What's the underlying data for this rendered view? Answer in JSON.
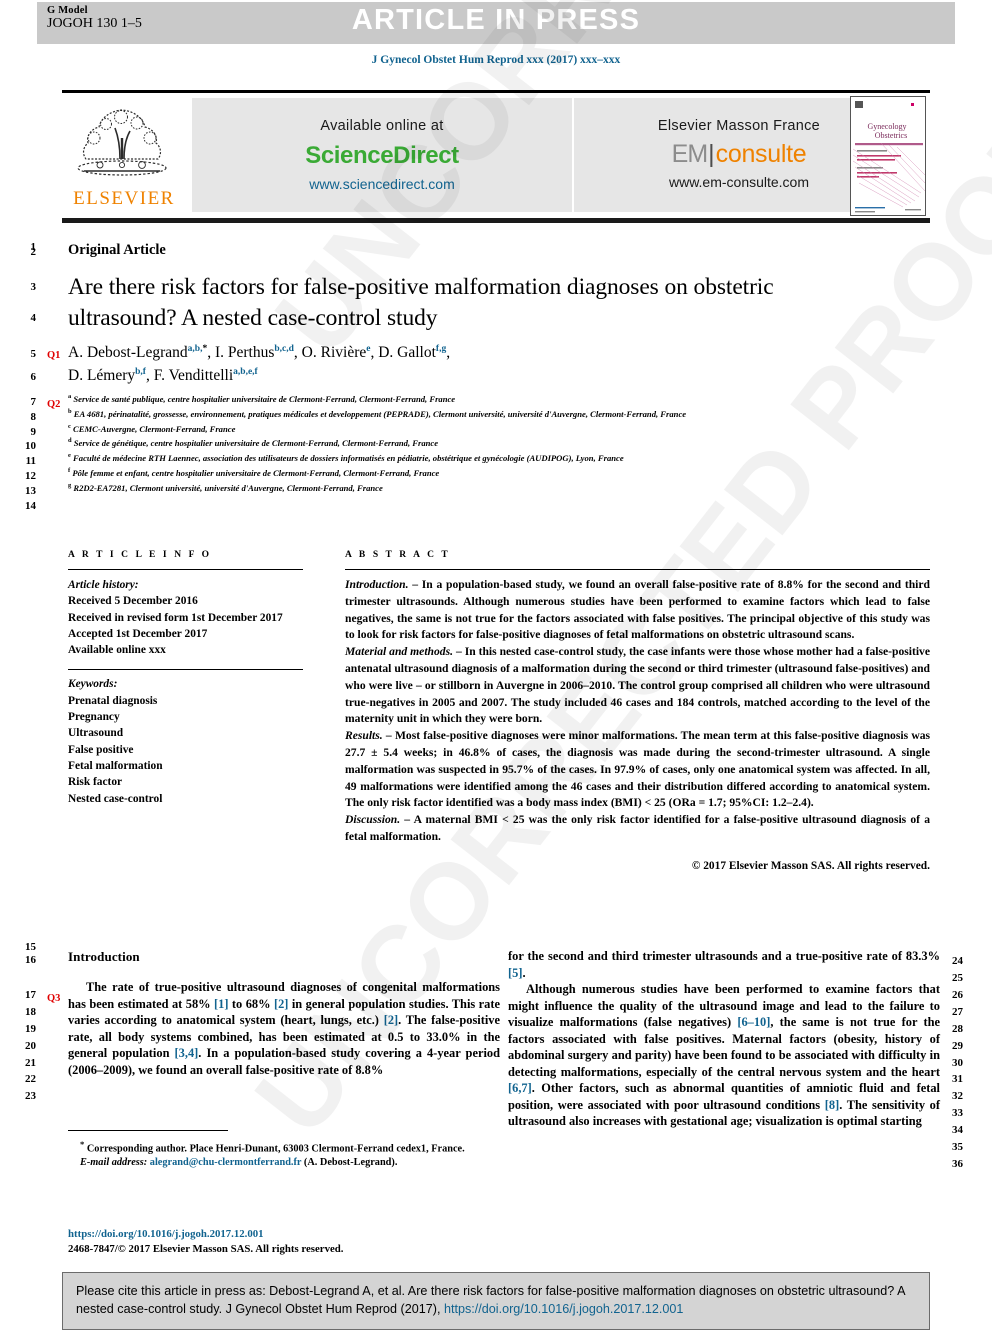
{
  "header": {
    "g_model_label": "G Model",
    "journal_code": "JOGOH 130 1–5",
    "status_banner": "ARTICLE IN PRESS",
    "journal_line": "J Gynecol Obstet Hum Reprod xxx (2017) xxx–xxx"
  },
  "masthead": {
    "elsevier_wordmark": "ELSEVIER",
    "sciencedirect": {
      "available_label": "Available online at",
      "brand": "ScienceDirect",
      "url": "www.sciencedirect.com"
    },
    "emconsulte": {
      "publisher": "Elsevier Masson France",
      "brand_first": "EM",
      "brand_divider": "|",
      "brand_second": "consulte",
      "url": "www.em-consulte.com"
    },
    "cover_title_line1": "Gynecology",
    "cover_title_line2": "Obstetrics"
  },
  "colors": {
    "link_blue": "#11638f",
    "sciencedirect_green": "#3aaa35",
    "elsevier_orange": "#ef8200",
    "query_red": "#e00000",
    "banner_grey": "#e6e6e6",
    "topbar_grey": "#c9c9c9",
    "citebox_grey": "#d4d4d4"
  },
  "line_numbers_top": [
    "1",
    "2",
    "3",
    "4",
    "5",
    "6",
    "7",
    "8",
    "9",
    "10",
    "11",
    "12",
    "13",
    "14"
  ],
  "line_numbers_bottom": [
    "15",
    "16",
    "17",
    "18",
    "19",
    "20",
    "21",
    "22",
    "23"
  ],
  "line_numbers_right": [
    "24",
    "25",
    "26",
    "27",
    "28",
    "29",
    "30",
    "31",
    "32",
    "33",
    "34",
    "35",
    "36"
  ],
  "query_markers": {
    "q1": "Q1",
    "q2": "Q2",
    "q3": "Q3"
  },
  "article": {
    "kicker": "Original Article",
    "title": "Are there risk factors for false-positive malformation diagnoses on obstetric ultrasound? A nested case-control study",
    "authors_line1_pre": "A. Debost-Legrand",
    "authors_line1_sup1": "a,b,",
    "authors_line1_star": "*",
    "authors_line1_b": ", I. Perthus",
    "authors_line1_sup2": "b,c,d",
    "authors_line1_c": ", O. Rivière",
    "authors_line1_sup3": "e",
    "authors_line1_d": ", D. Gallot",
    "authors_line1_sup4": "f,g",
    "authors_line2_a": "D. Lémery",
    "authors_line2_sup1": "b,f",
    "authors_line2_b": ", F. Vendittelli",
    "authors_line2_sup2": "a,b,e,f",
    "affiliations": [
      {
        "marker": "a",
        "text": "Service de santé publique, centre hospitalier universitaire de Clermont-Ferrand, Clermont-Ferrand, France"
      },
      {
        "marker": "b",
        "text": "EA 4681, périnatalité, grossesse, environnement, pratiques médicales et developpement (PEPRADE), Clermont université, université d'Auvergne, Clermont-Ferrand, France"
      },
      {
        "marker": "c",
        "text": "CEMC-Auvergne, Clermont-Ferrand, France"
      },
      {
        "marker": "d",
        "text": "Service de génétique, centre hospitalier universitaire de Clermont-Ferrand, Clermont-Ferrand, France"
      },
      {
        "marker": "e",
        "text": "Faculté de médecine RTH Laennec, association des utilisateurs de dossiers informatisés en pédiatrie, obstétrique et gynécologie (AUDIPOG), Lyon, France"
      },
      {
        "marker": "f",
        "text": "Pôle femme et enfant, centre hospitalier universitaire de Clermont-Ferrand, Clermont-Ferrand, France"
      },
      {
        "marker": "g",
        "text": "R2D2-EA7281, Clermont université, université d'Auvergne, Clermont-Ferrand, France"
      }
    ]
  },
  "article_info": {
    "heading": "A R T I C L E   I N F O",
    "history_label": "Article history:",
    "history": [
      "Received 5 December 2016",
      "Received in revised form 1st December 2017",
      "Accepted 1st December 2017",
      "Available online xxx"
    ],
    "keywords_label": "Keywords:",
    "keywords": [
      "Prenatal diagnosis",
      "Pregnancy",
      "Ultrasound",
      "False positive",
      "Fetal malformation",
      "Risk factor",
      "Nested case-control"
    ]
  },
  "abstract": {
    "heading": "A B S T R A C T",
    "sections": [
      {
        "label": "Introduction.",
        "dash": " – ",
        "text": "In a population-based study, we found an overall false-positive rate of 8.8% for the second and third trimester ultrasounds. Although numerous studies have been performed to examine factors which lead to false negatives, the same is not true for the factors associated with false positives. The principal objective of this study was to look for risk factors for false-positive diagnoses of fetal malformations on obstetric ultrasound scans."
      },
      {
        "label": "Material and methods.",
        "dash": " – ",
        "text": "In this nested case-control study, the case infants were those whose mother had a false-positive antenatal ultrasound diagnosis of a malformation during the second or third trimester (ultrasound false-positives) and who were live – or stillborn in Auvergne in 2006–2010. The control group comprised all children who were ultrasound true-negatives in 2005 and 2007. The study included 46 cases and 184 controls, matched according to the level of the maternity unit in which they were born."
      },
      {
        "label": "Results.",
        "dash": " – ",
        "text": "Most false-positive diagnoses were minor malformations. The mean term at this false-positive diagnosis was 27.7 ± 5.4 weeks; in 46.8% of cases, the diagnosis was made during the second-trimester ultrasound. A single malformation was suspected in 95.7% of the cases. In 97.9% of cases, only one anatomical system was affected. In all, 49 malformations were identified among the 46 cases and their distribution differed according to anatomical system. The only risk factor identified was a body mass index (BMI) < 25 (ORa = 1.7; 95%CI: 1.2–2.4)."
      },
      {
        "label": "Discussion.",
        "dash": " – ",
        "text": "A maternal BMI < 25 was the only risk factor identified for a false-positive ultrasound diagnosis of a fetal malformation."
      }
    ],
    "copyright": "© 2017 Elsevier Masson SAS. All rights reserved."
  },
  "body": {
    "section_heading": "Introduction",
    "left_paragraph_1a": "The rate of true-positive ultrasound diagnoses of congenital malformations has been estimated at 58% ",
    "ref_1": "[1]",
    "left_paragraph_1b": " to 68% ",
    "ref_2": "[2]",
    "left_paragraph_1c": " in general population studies. This rate varies according to anatomical system (heart, lungs, etc.) ",
    "ref_2b": "[2]",
    "left_paragraph_1d": ". The false-positive rate, all body systems combined, has been estimated at 0.5 to 33.0% in the general population ",
    "ref_34": "[3,4]",
    "left_paragraph_1e": ". In a population-based study covering a 4-year period (2006–2009), we found an overall false-positive rate of 8.8%",
    "right_paragraph_1a": "for the second and third trimester ultrasounds and a true-positive rate of 83.3% ",
    "ref_5": "[5]",
    "right_paragraph_1b": ".",
    "right_paragraph_2a": "Although numerous studies have been performed to examine factors that might influence the quality of the ultrasound image and lead to the failure to visualize malformations (false negatives) ",
    "ref_610": "[6–10]",
    "right_paragraph_2b": ", the same is not true for the factors associated with false positives. Maternal factors (obesity, history of abdominal surgery and parity) have been found to be associated with difficulty in detecting malformations, especially of the central nervous system and the heart ",
    "ref_67": "[6,7]",
    "right_paragraph_2c": ". Other factors, such as abnormal quantities of amniotic fluid and fetal position, were associated with poor ultrasound conditions ",
    "ref_8": "[8]",
    "right_paragraph_2d": ". The sensitivity of ultrasound also increases with gestational age; visualization is optimal starting"
  },
  "footnotes": {
    "corresponding_star": "*",
    "corresponding_text": " Corresponding author. Place Henri-Dunant, 63003 Clermont-Ferrand cedex1, France.",
    "email_label": "E-mail address:",
    "email": "alegrand@chu-clermontferrand.fr",
    "email_suffix": " (A. Debost-Legrand).",
    "doi": "https://doi.org/10.1016/j.jogoh.2017.12.001",
    "issn_line": "2468-7847/© 2017 Elsevier Masson SAS. All rights reserved."
  },
  "citation_box": {
    "text": "Please cite this article in press as: Debost-Legrand A, et al. Are there risk factors for false-positive malformation diagnoses on obstetric ultrasound? A nested case-control study. J Gynecol Obstet Hum Reprod (2017), ",
    "doi": "https://doi.org/10.1016/j.jogoh.2017.12.001"
  },
  "watermark": {
    "line1": "UNCORRECTED PROOF",
    "line2": "UNCORRECTED PROOF"
  }
}
